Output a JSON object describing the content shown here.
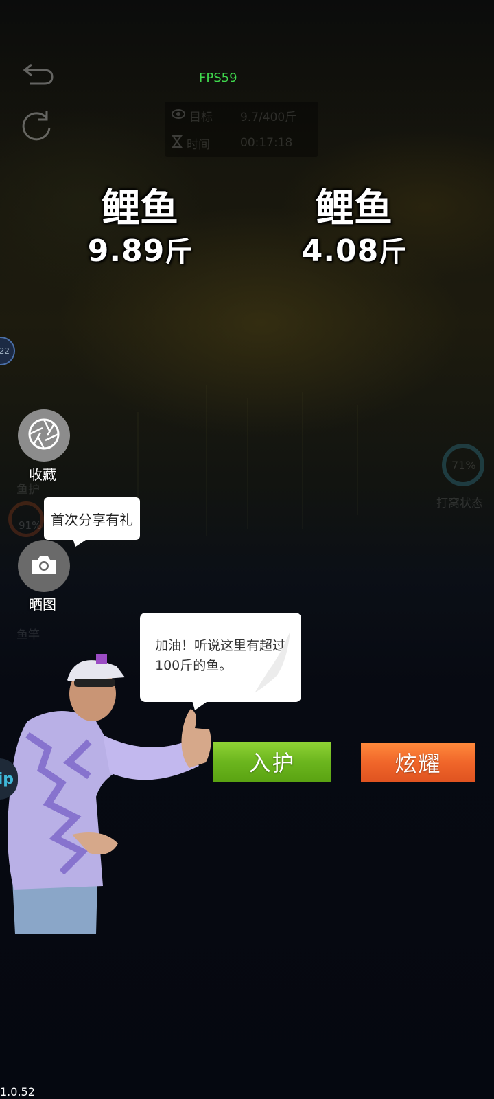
{
  "fps": "FPS59",
  "hud": {
    "target_label": "目标",
    "target_value": "9.7/400斤",
    "time_label": "时间",
    "time_value": "00:17:18"
  },
  "catches": [
    {
      "name": "鲤鱼",
      "weight": "9.89",
      "unit": "斤"
    },
    {
      "name": "鲤鱼",
      "weight": "4.08",
      "unit": "斤"
    }
  ],
  "left_badge": "22",
  "side_menu": {
    "favorite_label": "收藏",
    "share_label": "晒图",
    "share_tip": "首次分享有礼",
    "dim_labels": [
      "鱼护",
      "91%",
      "鱼竿"
    ]
  },
  "right_status": {
    "percent": "71%",
    "label": "打窝状态"
  },
  "speech": "加油！听说这里有超过100斤的鱼。",
  "buttons": {
    "keep": "入护",
    "show_off": "炫耀"
  },
  "left_edge_text": "ip",
  "version": "1.0.52",
  "colors": {
    "fps": "#3fd84d",
    "keep_button": "#6cb61e",
    "show_off_button": "#f0662a"
  },
  "icons": [
    "back-arrow-icon",
    "refresh-icon",
    "eye-icon",
    "hourglass-icon",
    "shutter-icon",
    "camera-icon"
  ]
}
